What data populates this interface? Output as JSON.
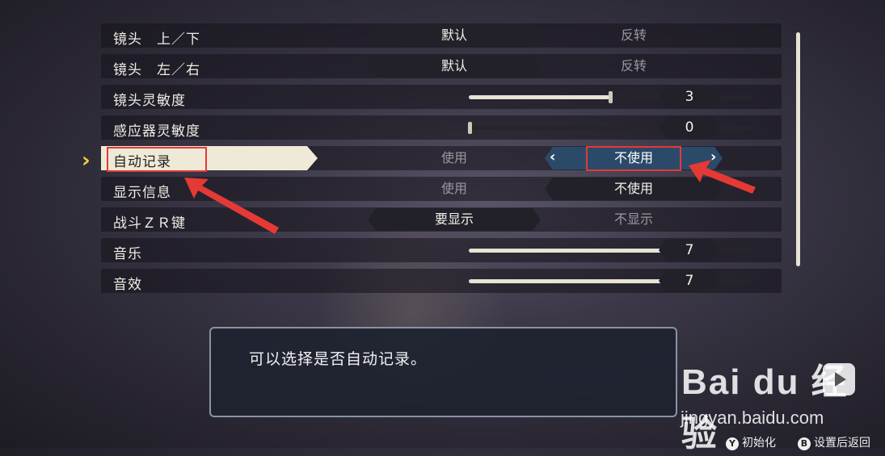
{
  "settings": {
    "rows": [
      {
        "label": "镜头　上／下",
        "opt1": "默认",
        "opt2": "反转"
      },
      {
        "label": "镜头　左／右",
        "opt1": "默认",
        "opt2": "反转"
      },
      {
        "label": "镜头灵敏度",
        "value": "3",
        "level": 0.5
      },
      {
        "label": "感应器灵敏度",
        "value": "0",
        "level": 0.0
      },
      {
        "label": "自动记录",
        "opt1": "使用",
        "opt2": "不使用"
      },
      {
        "label": "显示信息",
        "opt1": "使用",
        "opt2": "不使用"
      },
      {
        "label": "战斗ＺＲ键",
        "opt1": "要显示",
        "opt2": "不显示"
      },
      {
        "label": "音乐",
        "value": "7",
        "level": 0.7
      },
      {
        "label": "音效",
        "value": "7",
        "level": 0.7
      }
    ]
  },
  "info": {
    "text": "可以选择是否自动记录。"
  },
  "footer": {
    "y_icon": "Y",
    "y_label": "初始化",
    "b_icon": "B",
    "b_label": "设置后返回"
  },
  "watermark": {
    "brand": "Bai du 经验",
    "url": "jingyan.baidu.com"
  },
  "arrows": {
    "left": "‹",
    "right": "›"
  },
  "colors": {
    "accent": "#f2d046",
    "highlight": "#e53935",
    "selected_bar": "#2b4a6a"
  }
}
